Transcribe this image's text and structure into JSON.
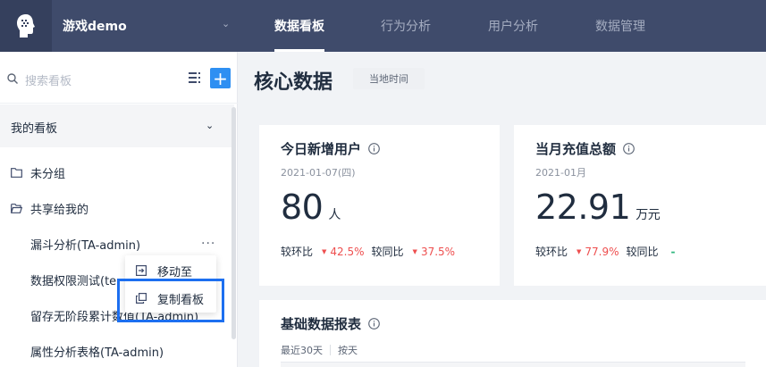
{
  "app": {
    "name": "游戏demo"
  },
  "nav": {
    "items": [
      "数据看板",
      "行为分析",
      "用户分析",
      "数据管理"
    ],
    "active_index": 0
  },
  "sidebar": {
    "search_placeholder": "搜索看板",
    "group_title": "我的看板",
    "folders": [
      "未分组",
      "共享给我的"
    ],
    "boards": [
      "漏斗分析(TA-admin)",
      "数据权限测试(te",
      "留存无阶段累计数值(TA-admin)",
      "属性分析表格(TA-admin)"
    ],
    "more_dots": "···"
  },
  "context_menu": {
    "items": [
      "移动至",
      "复制看板"
    ]
  },
  "main": {
    "title": "核心数据",
    "time_tag": "当地时间",
    "cards": [
      {
        "title": "今日新增用户",
        "date": "2021-01-07(四)",
        "value": "80",
        "unit": "人",
        "mom_label": "较环比",
        "mom_value": "42.5%",
        "yoy_label": "较同比",
        "yoy_value": "37.5%"
      },
      {
        "title": "当月充值总额",
        "date": "2021-01月",
        "value": "22.91",
        "unit": "万元",
        "mom_label": "较环比",
        "mom_value": "77.9%",
        "yoy_label": "较同比",
        "yoy_value": "-"
      }
    ],
    "report": {
      "title": "基础数据报表",
      "range": "最近30天",
      "granularity": "按天"
    }
  },
  "colors": {
    "topbar": "#3f4b6b",
    "accent": "#2e8ff2",
    "down": "#ee4f4f",
    "highlight": "#1d6ff0"
  }
}
